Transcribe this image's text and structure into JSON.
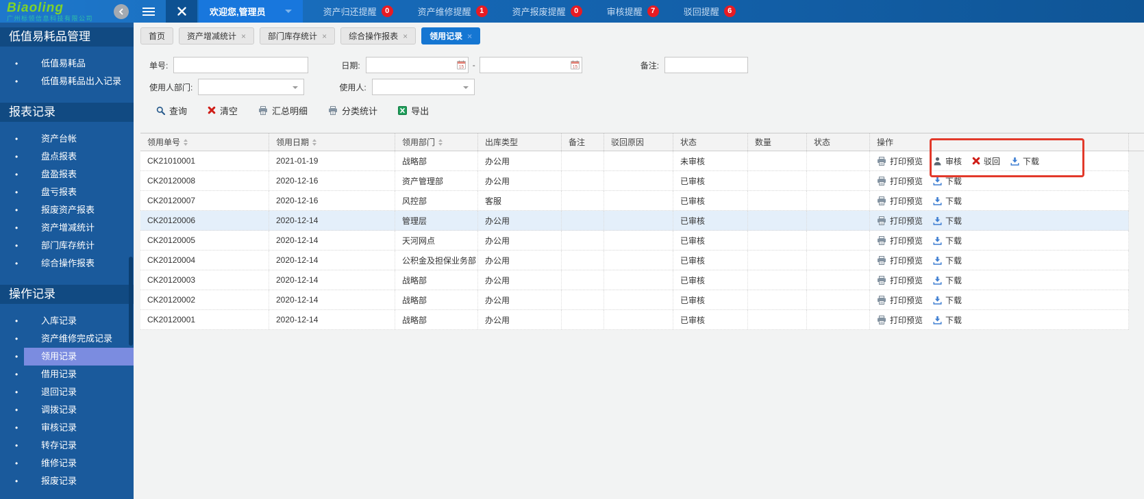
{
  "colors": {
    "topbar_blue": "#1566b3",
    "welcome_blue": "#1877dd",
    "sidebar_blue": "#1a5a9c",
    "section_header_blue": "#114a82",
    "active_item_blue": "#7b8ce0",
    "active_tab_blue": "#1576d2",
    "badge_red": "#e81b23",
    "annotation_red": "#e2392a",
    "highlighted_row_blue": "#e4effa",
    "brand_green": "#7fd32a"
  },
  "topbar": {
    "brand": "Biaoling",
    "company": "广州标领信息科技有限公司",
    "welcome": "欢迎您,管理员",
    "notifications": [
      {
        "label": "资产归还提醒",
        "count": "0"
      },
      {
        "label": "资产维修提醒",
        "count": "1"
      },
      {
        "label": "资产报废提醒",
        "count": "0"
      },
      {
        "label": "审核提醒",
        "count": "7"
      },
      {
        "label": "驳回提醒",
        "count": "6"
      }
    ]
  },
  "sidebar": {
    "sections": [
      {
        "title": "低值易耗品管理",
        "items": [
          {
            "label": "低值易耗品",
            "active": false
          },
          {
            "label": "低值易耗品出入记录",
            "active": false
          }
        ]
      },
      {
        "title": "报表记录",
        "items": [
          {
            "label": "资产台帐",
            "active": false
          },
          {
            "label": "盘点报表",
            "active": false
          },
          {
            "label": "盘盈报表",
            "active": false
          },
          {
            "label": "盘亏报表",
            "active": false
          },
          {
            "label": "报废资产报表",
            "active": false
          },
          {
            "label": "资产增减统计",
            "active": false
          },
          {
            "label": "部门库存统计",
            "active": false
          },
          {
            "label": "综合操作报表",
            "active": false
          }
        ]
      },
      {
        "title": "操作记录",
        "items": [
          {
            "label": "入库记录",
            "active": false
          },
          {
            "label": "资产维修完成记录",
            "active": false
          },
          {
            "label": "领用记录",
            "active": true
          },
          {
            "label": "借用记录",
            "active": false
          },
          {
            "label": "退回记录",
            "active": false
          },
          {
            "label": "调拨记录",
            "active": false
          },
          {
            "label": "审核记录",
            "active": false
          },
          {
            "label": "转存记录",
            "active": false
          },
          {
            "label": "维修记录",
            "active": false
          },
          {
            "label": "报废记录",
            "active": false
          }
        ]
      }
    ]
  },
  "tabs": [
    {
      "label": "首页",
      "closable": false,
      "active": false
    },
    {
      "label": "资产增减统计",
      "closable": true,
      "active": false
    },
    {
      "label": "部门库存统计",
      "closable": true,
      "active": false
    },
    {
      "label": "综合操作报表",
      "closable": true,
      "active": false
    },
    {
      "label": "领用记录",
      "closable": true,
      "active": true
    }
  ],
  "filters": {
    "order_no": {
      "label": "单号:",
      "value": ""
    },
    "date": {
      "label": "日期:",
      "separator": "-",
      "start": "",
      "end": ""
    },
    "remark": {
      "label": "备注:",
      "value": ""
    },
    "user_dept": {
      "label": "使用人部门:",
      "value": ""
    },
    "user": {
      "label": "使用人:",
      "value": ""
    }
  },
  "toolbar": {
    "buttons": [
      {
        "name": "query-button",
        "icon": "search",
        "label": "查询"
      },
      {
        "name": "clear-button",
        "icon": "clear-x",
        "label": "清空"
      },
      {
        "name": "summary-detail-button",
        "icon": "printer",
        "label": "汇总明细"
      },
      {
        "name": "category-stats-button",
        "icon": "printer",
        "label": "分类统计"
      },
      {
        "name": "export-button",
        "icon": "excel",
        "label": "导出"
      }
    ]
  },
  "table": {
    "columns": [
      {
        "label": "领用单号",
        "sortable": true
      },
      {
        "label": "领用日期",
        "sortable": true
      },
      {
        "label": "领用部门",
        "sortable": true
      },
      {
        "label": "出库类型",
        "sortable": false
      },
      {
        "label": "备注",
        "sortable": false
      },
      {
        "label": "驳回原因",
        "sortable": false
      },
      {
        "label": "状态",
        "sortable": false
      },
      {
        "label": "数量",
        "sortable": false
      },
      {
        "label": "状态",
        "sortable": false
      },
      {
        "label": "操作",
        "sortable": false
      }
    ],
    "rows": [
      {
        "cells": [
          "CK21010001",
          "2021-01-19",
          "战略部",
          "办公用",
          "",
          "",
          "未审核",
          "",
          ""
        ],
        "highlighted": false,
        "actions": [
          {
            "icon": "printer",
            "label": "打印预览"
          },
          {
            "icon": "person",
            "label": "审核"
          },
          {
            "icon": "reject-x",
            "label": "驳回"
          },
          {
            "icon": "download",
            "label": "下载"
          }
        ]
      },
      {
        "cells": [
          "CK20120008",
          "2020-12-16",
          "资产管理部",
          "办公用",
          "",
          "",
          "已审核",
          "",
          ""
        ],
        "highlighted": false,
        "actions": [
          {
            "icon": "printer",
            "label": "打印预览"
          },
          {
            "icon": "download",
            "label": "下载"
          }
        ]
      },
      {
        "cells": [
          "CK20120007",
          "2020-12-16",
          "风控部",
          "客服",
          "",
          "",
          "已审核",
          "",
          ""
        ],
        "highlighted": false,
        "actions": [
          {
            "icon": "printer",
            "label": "打印预览"
          },
          {
            "icon": "download",
            "label": "下载"
          }
        ]
      },
      {
        "cells": [
          "CK20120006",
          "2020-12-14",
          "管理层",
          "办公用",
          "",
          "",
          "已审核",
          "",
          ""
        ],
        "highlighted": true,
        "actions": [
          {
            "icon": "printer",
            "label": "打印预览"
          },
          {
            "icon": "download",
            "label": "下载"
          }
        ]
      },
      {
        "cells": [
          "CK20120005",
          "2020-12-14",
          "天河网点",
          "办公用",
          "",
          "",
          "已审核",
          "",
          ""
        ],
        "highlighted": false,
        "actions": [
          {
            "icon": "printer",
            "label": "打印预览"
          },
          {
            "icon": "download",
            "label": "下载"
          }
        ]
      },
      {
        "cells": [
          "CK20120004",
          "2020-12-14",
          "公积金及担保业务部",
          "办公用",
          "",
          "",
          "已审核",
          "",
          ""
        ],
        "highlighted": false,
        "actions": [
          {
            "icon": "printer",
            "label": "打印预览"
          },
          {
            "icon": "download",
            "label": "下载"
          }
        ]
      },
      {
        "cells": [
          "CK20120003",
          "2020-12-14",
          "战略部",
          "办公用",
          "",
          "",
          "已审核",
          "",
          ""
        ],
        "highlighted": false,
        "actions": [
          {
            "icon": "printer",
            "label": "打印预览"
          },
          {
            "icon": "download",
            "label": "下载"
          }
        ]
      },
      {
        "cells": [
          "CK20120002",
          "2020-12-14",
          "战略部",
          "办公用",
          "",
          "",
          "已审核",
          "",
          ""
        ],
        "highlighted": false,
        "actions": [
          {
            "icon": "printer",
            "label": "打印预览"
          },
          {
            "icon": "download",
            "label": "下载"
          }
        ]
      },
      {
        "cells": [
          "CK20120001",
          "2020-12-14",
          "战略部",
          "办公用",
          "",
          "",
          "已审核",
          "",
          ""
        ],
        "highlighted": false,
        "actions": [
          {
            "icon": "printer",
            "label": "打印预览"
          },
          {
            "icon": "download",
            "label": "下载"
          }
        ]
      }
    ]
  }
}
